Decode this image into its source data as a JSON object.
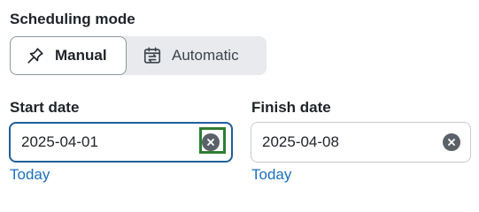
{
  "scheduling": {
    "label": "Scheduling mode",
    "options": [
      {
        "label": "Manual",
        "icon": "pin-icon",
        "selected": true
      },
      {
        "label": "Automatic",
        "icon": "calendar-sync-icon",
        "selected": false
      }
    ]
  },
  "start": {
    "label": "Start date",
    "value": "2025-04-01",
    "today_label": "Today",
    "clear_icon": "clear-icon"
  },
  "finish": {
    "label": "Finish date",
    "value": "2025-04-08",
    "today_label": "Today",
    "clear_icon": "clear-icon"
  },
  "colors": {
    "link": "#1a6fbe",
    "focus_border": "#1f5f9a",
    "focus_ring": "#2e7d32"
  }
}
